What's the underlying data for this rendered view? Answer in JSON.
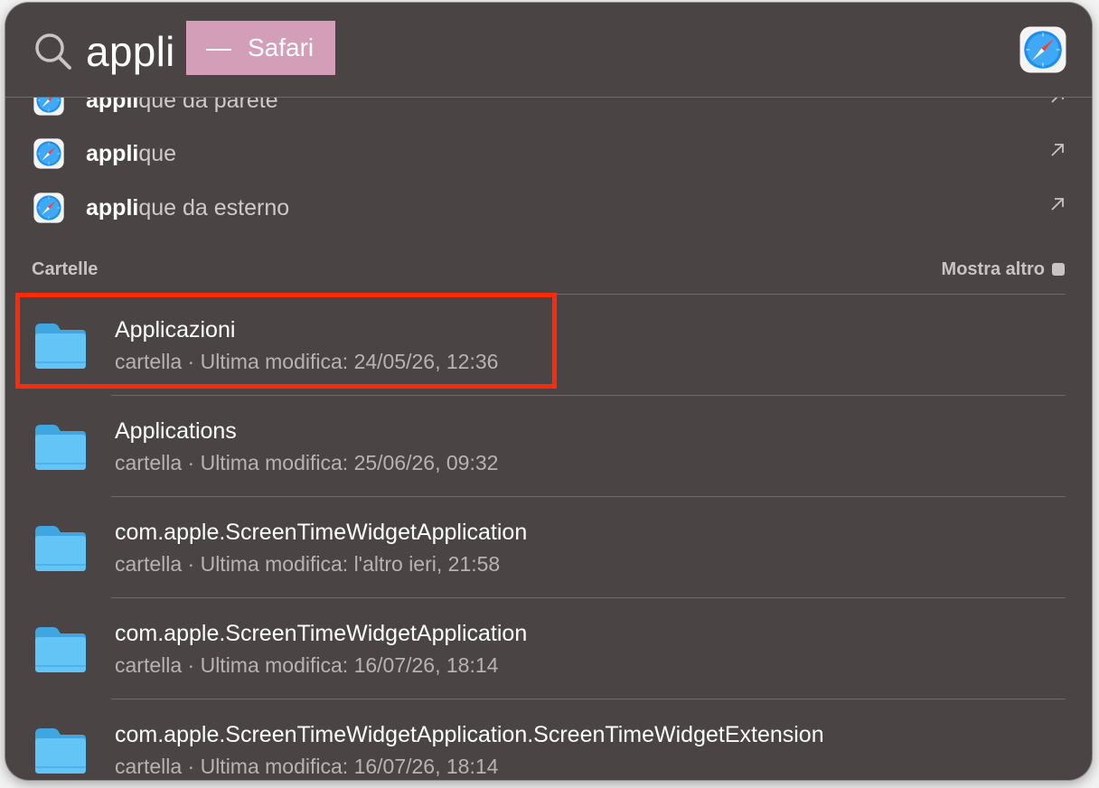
{
  "search": {
    "query": "appli",
    "completion_dash": "—",
    "completion_app": "Safari",
    "app_icon": "safari-icon"
  },
  "suggestions": [
    {
      "match": "appli",
      "rest": "que da parete",
      "icon": "safari-icon"
    },
    {
      "match": "appli",
      "rest": "que",
      "icon": "safari-icon"
    },
    {
      "match": "appli",
      "rest": "que da esterno",
      "icon": "safari-icon"
    }
  ],
  "folders_section": {
    "title": "Cartelle",
    "more_label": "Mostra altro",
    "items": [
      {
        "title": "Applicazioni",
        "subtitle": "cartella · Ultima modifica: 24/05/26, 12:36",
        "highlighted": true
      },
      {
        "title": "Applications",
        "subtitle": "cartella · Ultima modifica: 25/06/26, 09:32"
      },
      {
        "title": "com.apple.ScreenTimeWidgetApplication",
        "subtitle": "cartella · Ultima modifica: l'altro ieri, 21:58"
      },
      {
        "title": "com.apple.ScreenTimeWidgetApplication",
        "subtitle": "cartella · Ultima modifica: 16/07/26, 18:14"
      },
      {
        "title": "com.apple.ScreenTimeWidgetApplication.ScreenTimeWidgetExtension",
        "subtitle": "cartella · Ultima modifica: 16/07/26, 18:14"
      }
    ]
  },
  "colors": {
    "panel": "#4a4544",
    "completion_bg": "#d39eb8",
    "highlight_border": "#ff2a0a",
    "folder_blue": "#5cc1f3"
  }
}
